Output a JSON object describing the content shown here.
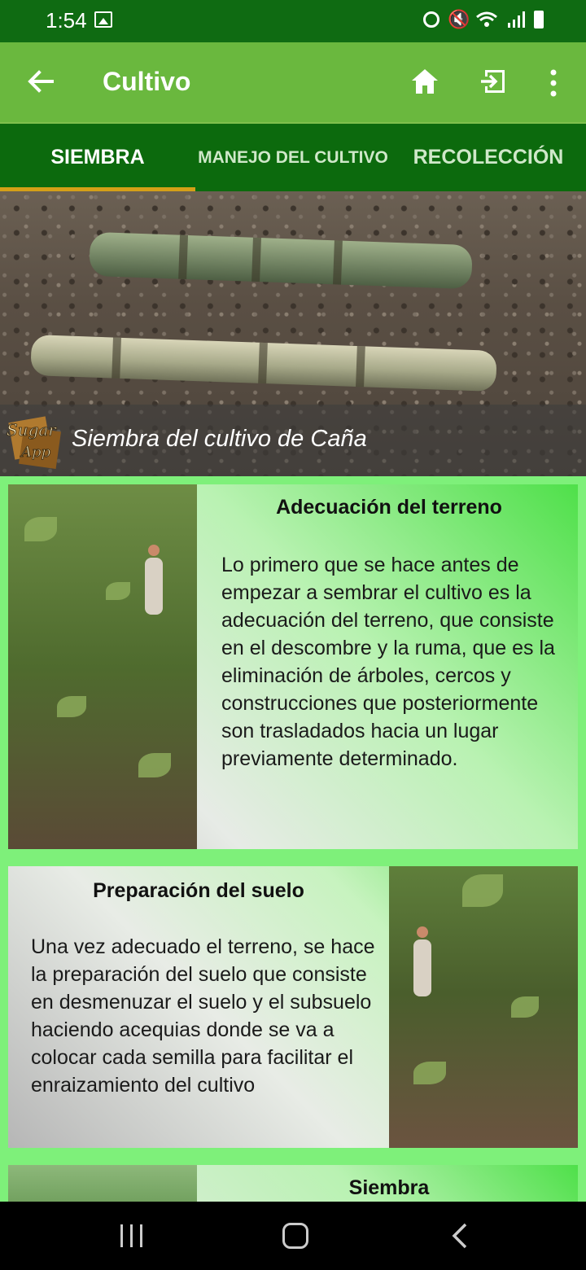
{
  "status_bar": {
    "time": "1:54"
  },
  "app_bar": {
    "title": "Cultivo"
  },
  "tabs": [
    {
      "label": "SIEMBRA",
      "selected": true
    },
    {
      "label": "MANEJO DEL CULTIVO",
      "selected": false
    },
    {
      "label": "RECOLECCIÓN",
      "selected": false
    }
  ],
  "hero": {
    "caption": "Siembra del cultivo de Caña",
    "logo_text": "Sugar App"
  },
  "sections": [
    {
      "title": "Adecuación del terreno",
      "text": "Lo primero que se hace antes de empezar a sembrar el cultivo es la adecuación del terreno, que consiste en el descombre y la ruma, que es la eliminación de árboles, cercos y construcciones que posteriormente son trasladados hacia un lugar previamente determinado."
    },
    {
      "title": "Preparación del suelo",
      "text": "Una vez adecuado el terreno, se hace la preparación del suelo que consiste en desmenuzar el suelo y el subsuelo haciendo acequias donde se va a colocar cada semilla para facilitar el enraizamiento del cultivo"
    },
    {
      "title": "Siembra",
      "text": ""
    }
  ],
  "colors": {
    "status_bar": "#0f6b12",
    "app_bar": "#6ab83e",
    "tabs": "#0c6a0d",
    "tab_indicator": "#d4a017",
    "content_bg": "#7ef07a"
  }
}
